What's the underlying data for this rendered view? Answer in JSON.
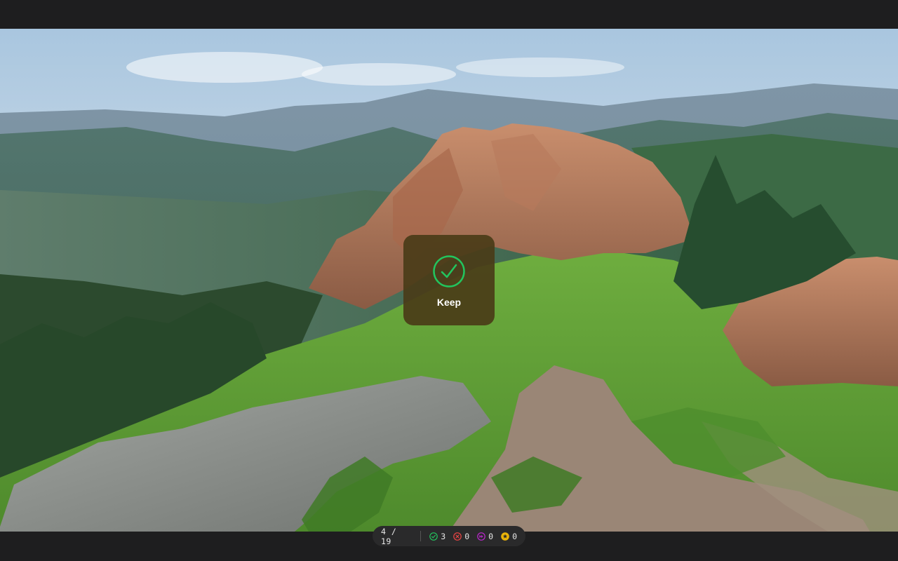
{
  "viewer": {
    "photo_alt": "mountain landscape photo",
    "feedback": {
      "label": "Keep",
      "icon": "check-circle-icon",
      "color": "#22c55e"
    },
    "status": {
      "position": "4",
      "total": "19",
      "separator": "/",
      "stats": [
        {
          "name": "kept",
          "icon": "check-circle-icon",
          "color": "#22c55e",
          "count": "3"
        },
        {
          "name": "rejected",
          "icon": "x-circle-icon",
          "color": "#ef4444",
          "count": "0"
        },
        {
          "name": "skipped",
          "icon": "skip-forward-icon",
          "color": "#c026d3",
          "count": "0"
        },
        {
          "name": "starred",
          "icon": "star-circle-icon",
          "color": "#eab308",
          "count": "0"
        }
      ]
    }
  }
}
